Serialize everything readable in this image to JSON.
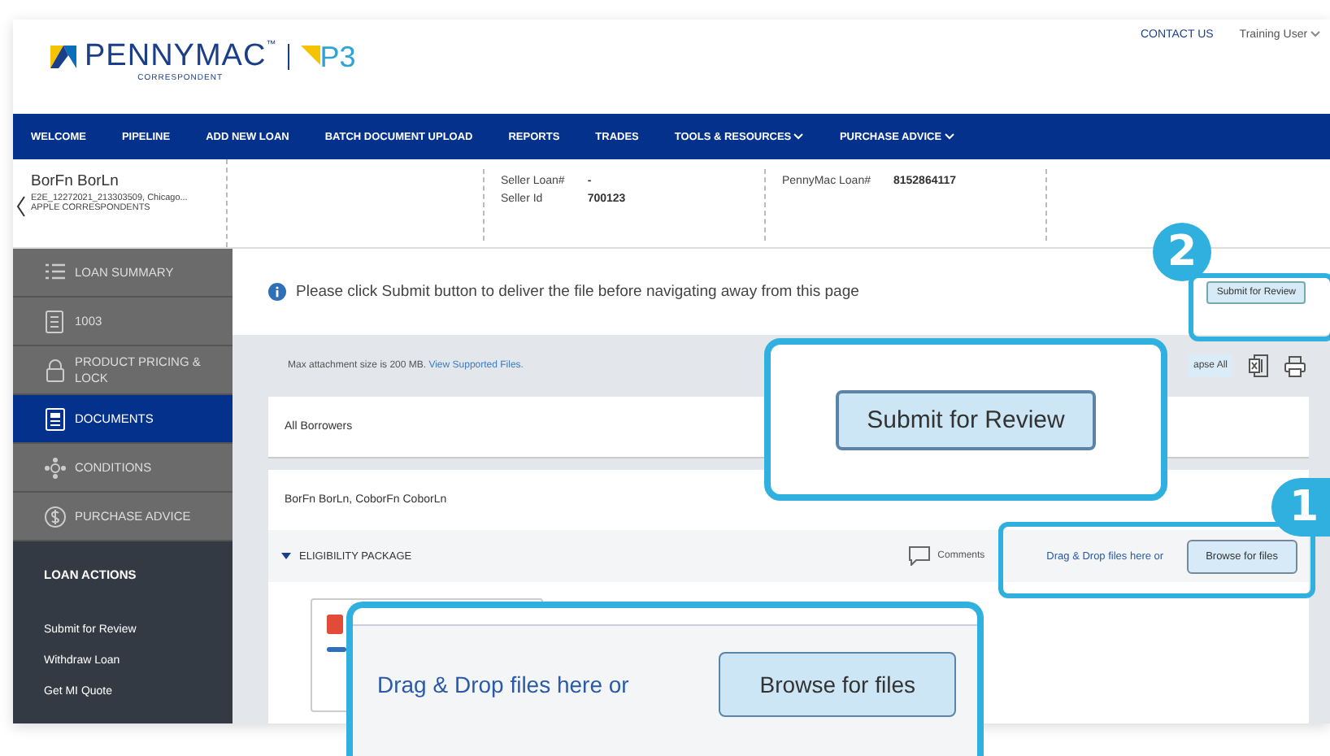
{
  "header": {
    "brand": "PENNYMAC",
    "trademark": "™",
    "tagline": "CORRESPONDENT",
    "product": "P3",
    "contact": "CONTACT US",
    "user": "Training User"
  },
  "nav": [
    {
      "label": "WELCOME",
      "dropdown": false
    },
    {
      "label": "PIPELINE",
      "dropdown": false
    },
    {
      "label": "ADD NEW LOAN",
      "dropdown": false
    },
    {
      "label": "BATCH DOCUMENT UPLOAD",
      "dropdown": false
    },
    {
      "label": "REPORTS",
      "dropdown": false
    },
    {
      "label": "TRADES",
      "dropdown": false
    },
    {
      "label": "TOOLS & RESOURCES",
      "dropdown": true
    },
    {
      "label": "PURCHASE ADVICE",
      "dropdown": true
    }
  ],
  "loan": {
    "name": "BorFn BorLn",
    "line_1": "E2E_12272021_213303509, Chicago...",
    "line_2": "APPLE CORRESPONDENTS",
    "fields": [
      {
        "label": "Seller Loan#",
        "value": "-"
      },
      {
        "label": "Seller Id",
        "value": "700123"
      },
      {
        "label": "PennyMac Loan#",
        "value": "8152864117"
      }
    ]
  },
  "sidebar": {
    "items": [
      {
        "label": "LOAN SUMMARY",
        "selected": false
      },
      {
        "label": "1003",
        "selected": false
      },
      {
        "label": "PRODUCT PRICING & LOCK",
        "selected": false
      },
      {
        "label": "DOCUMENTS",
        "selected": true
      },
      {
        "label": "CONDITIONS",
        "selected": false
      },
      {
        "label": "PURCHASE ADVICE",
        "selected": false
      }
    ],
    "actions_title": "LOAN ACTIONS",
    "actions": [
      "Submit for Review",
      "Withdraw Loan",
      "Get MI Quote"
    ]
  },
  "notice": {
    "text": "Please click Submit button to deliver the file before navigating away from this page",
    "button": "Submit for Review"
  },
  "toolbar": {
    "info": "Max attachment size is 200 MB.",
    "link": "View Supported Files.",
    "collapse": "apse All"
  },
  "sections": [
    {
      "title": "All Borrowers"
    },
    {
      "title": "BorFn BorLn, CoborFn CoborLn"
    }
  ],
  "package": {
    "title": "ELIGIBILITY PACKAGE",
    "expanded": true,
    "comments": "Comments",
    "drop_text": "Drag & Drop files here or",
    "browse": "Browse for files"
  },
  "callouts": [
    {
      "number": "2",
      "button": "Submit for Review"
    },
    {
      "number": "1",
      "drop_text": "Drag & Drop files here or",
      "button": "Browse for files"
    }
  ]
}
